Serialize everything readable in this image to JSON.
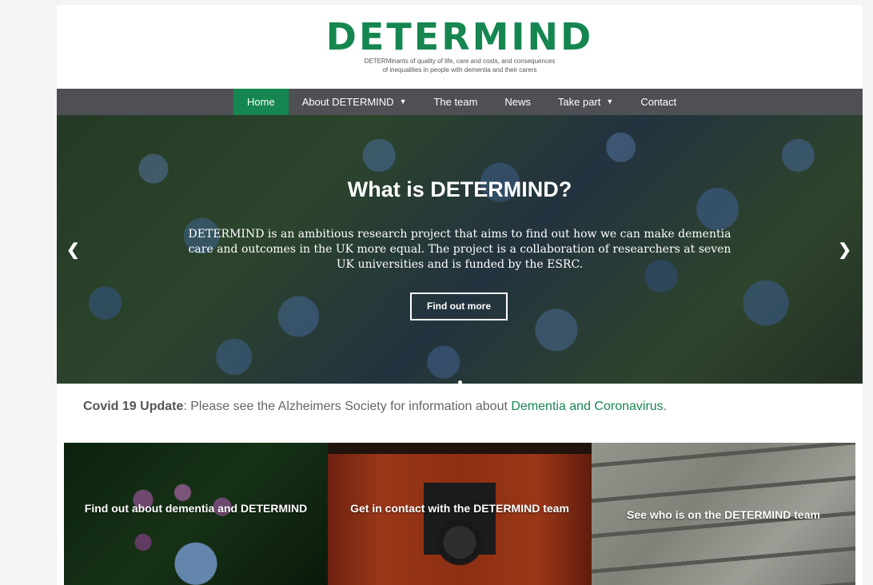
{
  "header": {
    "logo": "DETERMIND",
    "tagline_line1": "DETERMinants of quality of life, care and costs, and consequences",
    "tagline_line2": "of inequalities in people with dementia and their carers"
  },
  "nav": {
    "items": [
      {
        "label": "Home",
        "active": true
      },
      {
        "label": "About DETERMIND",
        "dropdown": true
      },
      {
        "label": "The team"
      },
      {
        "label": "News"
      },
      {
        "label": "Take part",
        "dropdown": true
      },
      {
        "label": "Contact"
      }
    ]
  },
  "hero": {
    "title": "What is DETERMIND?",
    "text": "DETERMIND is an ambitious research project that aims to find out how we can make dementia care and outcomes in the UK more equal. The project is a collaboration of researchers at seven UK universities and is funded by the ESRC.",
    "button": "Find out more",
    "prev_icon": "chevron-left-icon",
    "next_icon": "chevron-right-icon"
  },
  "covid": {
    "bold": "Covid 19 Update",
    "text": ": Please see the Alzheimers Society for information about ",
    "link": "Dementia and Coronavirus",
    "end": "."
  },
  "tiles": [
    {
      "label": "Find out about dementia and DETERMIND"
    },
    {
      "label": "Get in contact with the DETERMIND team"
    },
    {
      "label": "See who is on the DETERMIND team"
    }
  ],
  "colors": {
    "brand_green": "#15864f",
    "nav_bg": "#4e5054"
  }
}
